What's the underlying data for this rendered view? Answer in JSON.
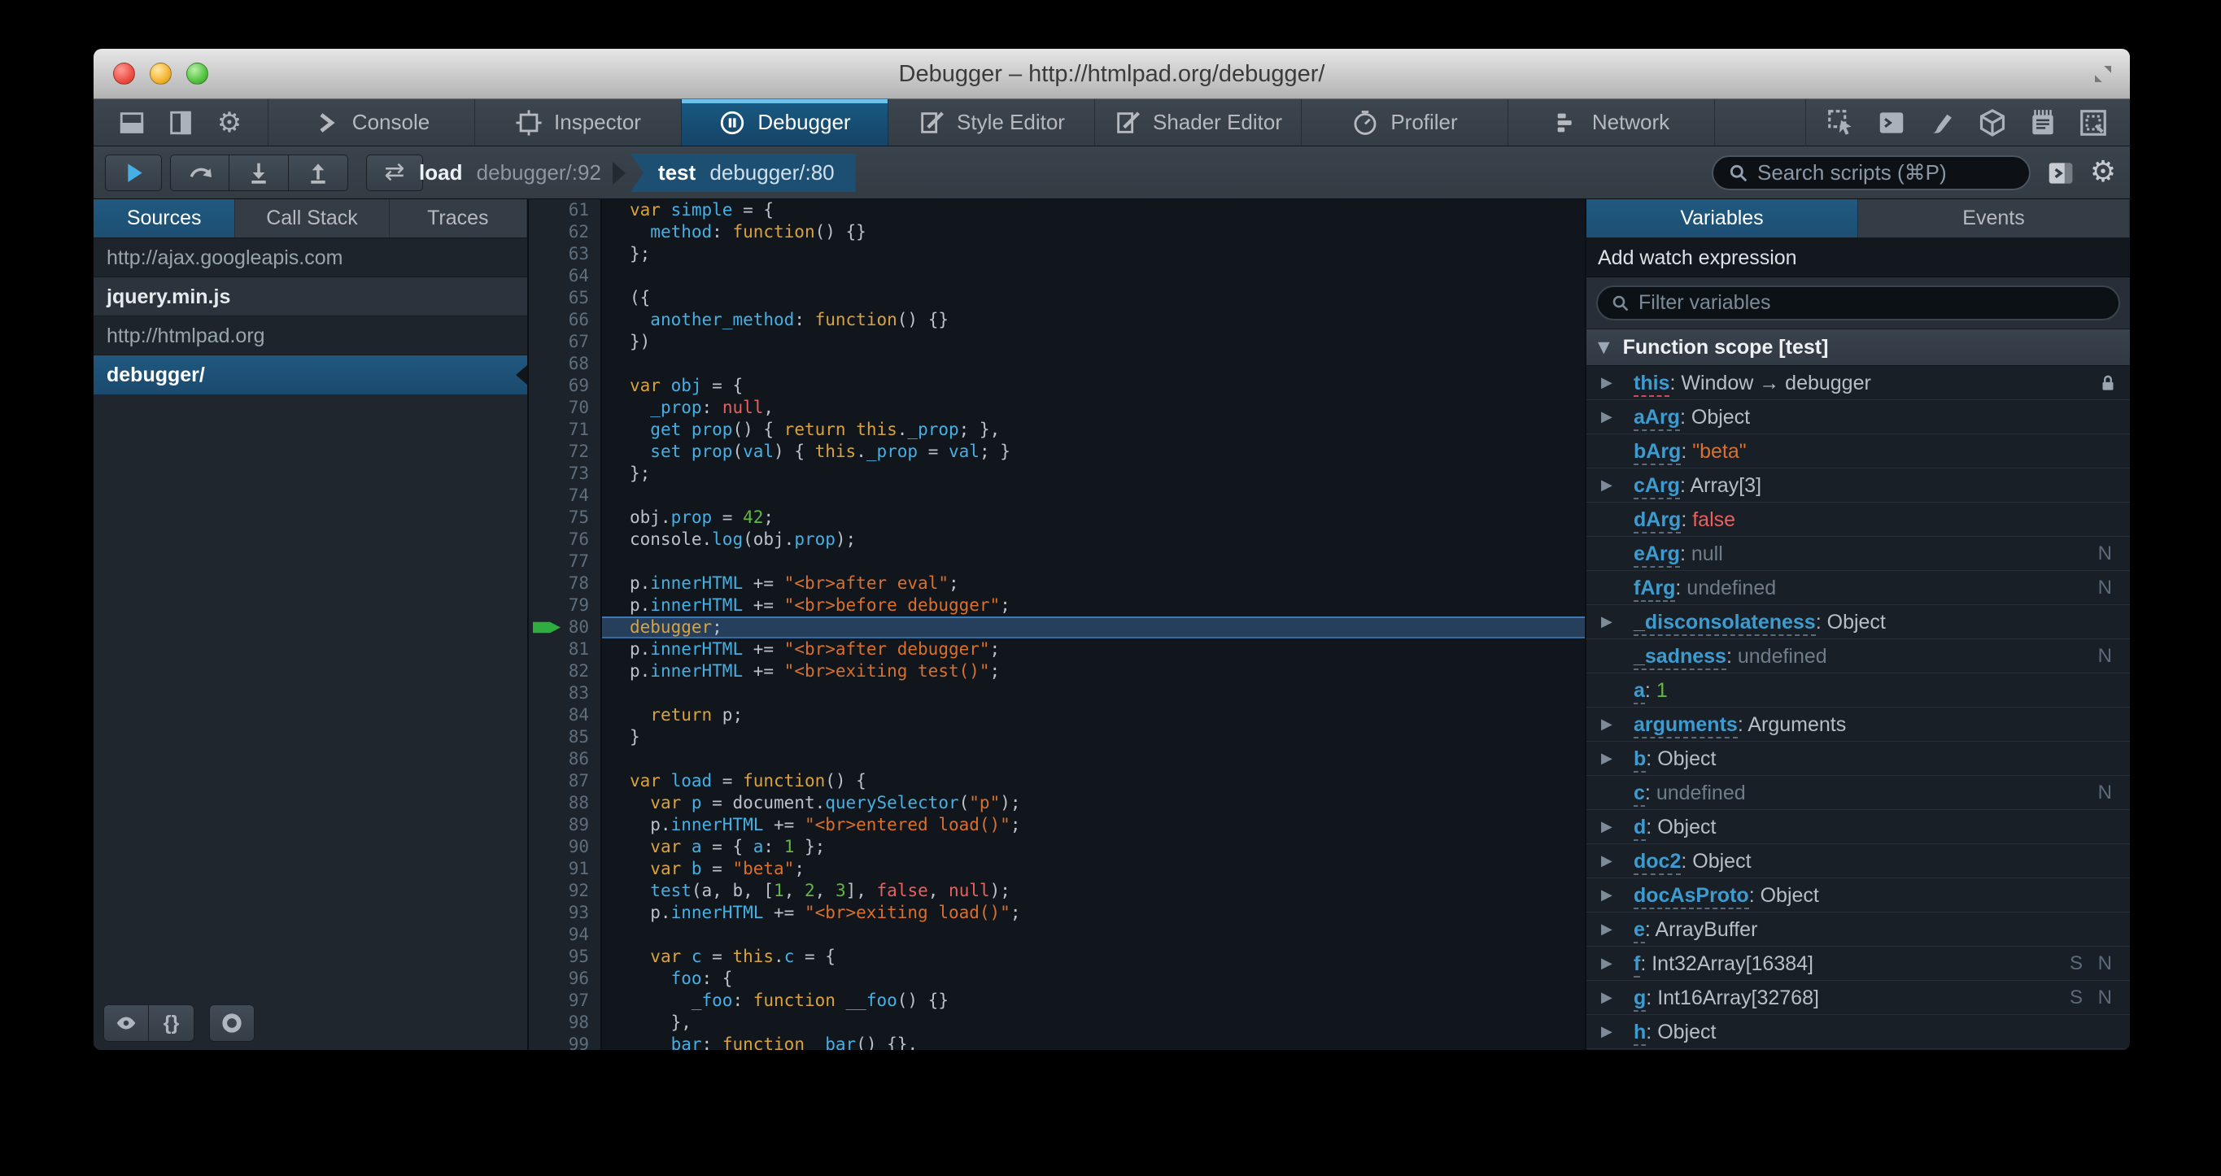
{
  "win": {
    "title": "Debugger – http://htmlpad.org/debugger/"
  },
  "colors": {
    "accent_blue": "#1d4f73",
    "tab_stripe": "#6cc1ea",
    "resume_blue": "#46afe3",
    "exec_arrow_green": "#2fae3f",
    "keyword": "#d9a23c",
    "identifier": "#46afe3",
    "string": "#d9702d",
    "number": "#64b648",
    "atom": "#e9605f"
  },
  "toolbar": {
    "dock_icons": [
      "dock-bottom",
      "dock-side",
      "toolbox-options"
    ],
    "tabs": [
      {
        "id": "console",
        "label": "Console"
      },
      {
        "id": "inspector",
        "label": "Inspector"
      },
      {
        "id": "debugger",
        "label": "Debugger",
        "active": true
      },
      {
        "id": "style-editor",
        "label": "Style Editor"
      },
      {
        "id": "shader-editor",
        "label": "Shader Editor"
      },
      {
        "id": "profiler",
        "label": "Profiler"
      },
      {
        "id": "network",
        "label": "Network"
      }
    ],
    "command_icons": [
      "pick-element",
      "split-console",
      "paintbrush",
      "tilt-3d",
      "scratchpad",
      "responsive-mode"
    ]
  },
  "debugbar": {
    "buttons": [
      "resume",
      "step-over",
      "step-in",
      "step-out",
      "blackbox"
    ],
    "crumbs": [
      {
        "fn": "load",
        "loc": "debugger/:92",
        "active": false
      },
      {
        "fn": "test",
        "loc": "debugger/:80",
        "active": true
      }
    ],
    "search_placeholder": "Search scripts (⌘P)"
  },
  "sources": {
    "tabs": [
      {
        "label": "Sources",
        "active": true
      },
      {
        "label": "Call Stack",
        "active": false
      },
      {
        "label": "Traces",
        "active": false
      }
    ],
    "items": [
      {
        "label": "http://ajax.googleapis.com",
        "kind": "header"
      },
      {
        "label": "jquery.min.js",
        "kind": "item"
      },
      {
        "label": "http://htmlpad.org",
        "kind": "header"
      },
      {
        "label": "debugger/",
        "kind": "selected"
      }
    ],
    "footer_buttons": [
      "blackbox-eye",
      "pretty-print",
      "toggle-breakpoints"
    ],
    "pretty_print_label": "{}"
  },
  "editor": {
    "first_line": 61,
    "exec_line": 80,
    "lines": [
      {
        "n": 61,
        "t": [
          [
            "k",
            "var "
          ],
          [
            "d",
            "simple"
          ],
          [
            "p",
            " = {"
          ]
        ]
      },
      {
        "n": 62,
        "t": [
          [
            "p",
            "  "
          ],
          [
            "d",
            "method"
          ],
          [
            "p",
            ": "
          ],
          [
            "k",
            "function"
          ],
          [
            "p",
            "() {}"
          ]
        ]
      },
      {
        "n": 63,
        "t": [
          [
            "p",
            "};"
          ]
        ]
      },
      {
        "n": 64,
        "t": []
      },
      {
        "n": 65,
        "t": [
          [
            "p",
            "({"
          ]
        ]
      },
      {
        "n": 66,
        "t": [
          [
            "p",
            "  "
          ],
          [
            "d",
            "another_method"
          ],
          [
            "p",
            ": "
          ],
          [
            "k",
            "function"
          ],
          [
            "p",
            "() {}"
          ]
        ]
      },
      {
        "n": 67,
        "t": [
          [
            "p",
            "})"
          ]
        ]
      },
      {
        "n": 68,
        "t": []
      },
      {
        "n": 69,
        "t": [
          [
            "k",
            "var "
          ],
          [
            "d",
            "obj"
          ],
          [
            "p",
            " = {"
          ]
        ]
      },
      {
        "n": 70,
        "t": [
          [
            "p",
            "  "
          ],
          [
            "d",
            "_prop"
          ],
          [
            "p",
            ": "
          ],
          [
            "a",
            "null"
          ],
          [
            "p",
            ","
          ]
        ]
      },
      {
        "n": 71,
        "t": [
          [
            "p",
            "  "
          ],
          [
            "d",
            "get prop"
          ],
          [
            "p",
            "() { "
          ],
          [
            "k",
            "return "
          ],
          [
            "k",
            "this"
          ],
          [
            "p",
            "."
          ],
          [
            "d",
            "_prop"
          ],
          [
            "p",
            "; },"
          ]
        ]
      },
      {
        "n": 72,
        "t": [
          [
            "p",
            "  "
          ],
          [
            "d",
            "set prop"
          ],
          [
            "p",
            "("
          ],
          [
            "d",
            "val"
          ],
          [
            "p",
            ") { "
          ],
          [
            "k",
            "this"
          ],
          [
            "p",
            "."
          ],
          [
            "d",
            "_prop"
          ],
          [
            "p",
            " = "
          ],
          [
            "d",
            "val"
          ],
          [
            "p",
            "; }"
          ]
        ]
      },
      {
        "n": 73,
        "t": [
          [
            "p",
            "};"
          ]
        ]
      },
      {
        "n": 74,
        "t": []
      },
      {
        "n": 75,
        "t": [
          [
            "p",
            "obj."
          ],
          [
            "d",
            "prop"
          ],
          [
            "p",
            " = "
          ],
          [
            "n",
            "42"
          ],
          [
            "p",
            ";"
          ]
        ]
      },
      {
        "n": 76,
        "t": [
          [
            "p",
            "console."
          ],
          [
            "d",
            "log"
          ],
          [
            "p",
            "(obj."
          ],
          [
            "d",
            "prop"
          ],
          [
            "p",
            ");"
          ]
        ]
      },
      {
        "n": 77,
        "t": []
      },
      {
        "n": 78,
        "t": [
          [
            "p",
            "p."
          ],
          [
            "d",
            "innerHTML"
          ],
          [
            "p",
            " += "
          ],
          [
            "s",
            "\"<br>after eval\""
          ],
          [
            "p",
            ";"
          ]
        ]
      },
      {
        "n": 79,
        "t": [
          [
            "p",
            "p."
          ],
          [
            "d",
            "innerHTML"
          ],
          [
            "p",
            " += "
          ],
          [
            "s",
            "\"<br>before debugger\""
          ],
          [
            "p",
            ";"
          ]
        ]
      },
      {
        "n": 80,
        "exec": true,
        "t": [
          [
            "k",
            "debugger"
          ],
          [
            "p",
            ";"
          ]
        ]
      },
      {
        "n": 81,
        "t": [
          [
            "p",
            "p."
          ],
          [
            "d",
            "innerHTML"
          ],
          [
            "p",
            " += "
          ],
          [
            "s",
            "\"<br>after debugger\""
          ],
          [
            "p",
            ";"
          ]
        ]
      },
      {
        "n": 82,
        "t": [
          [
            "p",
            "p."
          ],
          [
            "d",
            "innerHTML"
          ],
          [
            "p",
            " += "
          ],
          [
            "s",
            "\"<br>exiting test()\""
          ],
          [
            "p",
            ";"
          ]
        ]
      },
      {
        "n": 83,
        "t": []
      },
      {
        "n": 84,
        "t": [
          [
            "p",
            "  "
          ],
          [
            "k",
            "return"
          ],
          [
            "p",
            " p;"
          ]
        ]
      },
      {
        "n": 85,
        "t": [
          [
            "p",
            "}"
          ]
        ]
      },
      {
        "n": 86,
        "t": []
      },
      {
        "n": 87,
        "t": [
          [
            "k",
            "var "
          ],
          [
            "d",
            "load"
          ],
          [
            "p",
            " = "
          ],
          [
            "k",
            "function"
          ],
          [
            "p",
            "() {"
          ]
        ]
      },
      {
        "n": 88,
        "t": [
          [
            "p",
            "  "
          ],
          [
            "k",
            "var "
          ],
          [
            "d",
            "p"
          ],
          [
            "p",
            " = document."
          ],
          [
            "d",
            "querySelector"
          ],
          [
            "p",
            "("
          ],
          [
            "s",
            "\"p\""
          ],
          [
            "p",
            ");"
          ]
        ]
      },
      {
        "n": 89,
        "t": [
          [
            "p",
            "  p."
          ],
          [
            "d",
            "innerHTML"
          ],
          [
            "p",
            " += "
          ],
          [
            "s",
            "\"<br>entered load()\""
          ],
          [
            "p",
            ";"
          ]
        ]
      },
      {
        "n": 90,
        "t": [
          [
            "p",
            "  "
          ],
          [
            "k",
            "var "
          ],
          [
            "d",
            "a"
          ],
          [
            "p",
            " = { "
          ],
          [
            "d",
            "a"
          ],
          [
            "p",
            ": "
          ],
          [
            "n",
            "1"
          ],
          [
            "p",
            " };"
          ]
        ]
      },
      {
        "n": 91,
        "t": [
          [
            "p",
            "  "
          ],
          [
            "k",
            "var "
          ],
          [
            "d",
            "b"
          ],
          [
            "p",
            " = "
          ],
          [
            "s",
            "\"beta\""
          ],
          [
            "p",
            ";"
          ]
        ]
      },
      {
        "n": 92,
        "t": [
          [
            "p",
            "  "
          ],
          [
            "d",
            "test"
          ],
          [
            "p",
            "(a, b, ["
          ],
          [
            "n",
            "1"
          ],
          [
            "p",
            ", "
          ],
          [
            "n",
            "2"
          ],
          [
            "p",
            ", "
          ],
          [
            "n",
            "3"
          ],
          [
            "p",
            "], "
          ],
          [
            "a",
            "false"
          ],
          [
            "p",
            ", "
          ],
          [
            "a",
            "null"
          ],
          [
            "p",
            ");"
          ]
        ]
      },
      {
        "n": 93,
        "t": [
          [
            "p",
            "  p."
          ],
          [
            "d",
            "innerHTML"
          ],
          [
            "p",
            " += "
          ],
          [
            "s",
            "\"<br>exiting load()\""
          ],
          [
            "p",
            ";"
          ]
        ]
      },
      {
        "n": 94,
        "t": []
      },
      {
        "n": 95,
        "t": [
          [
            "p",
            "  "
          ],
          [
            "k",
            "var "
          ],
          [
            "d",
            "c"
          ],
          [
            "p",
            " = "
          ],
          [
            "k",
            "this"
          ],
          [
            "p",
            "."
          ],
          [
            "d",
            "c"
          ],
          [
            "p",
            " = {"
          ]
        ]
      },
      {
        "n": 96,
        "t": [
          [
            "p",
            "    "
          ],
          [
            "d",
            "foo"
          ],
          [
            "p",
            ": {"
          ]
        ]
      },
      {
        "n": 97,
        "t": [
          [
            "p",
            "      "
          ],
          [
            "d",
            "_foo"
          ],
          [
            "p",
            ": "
          ],
          [
            "k",
            "function "
          ],
          [
            "d",
            "__foo"
          ],
          [
            "p",
            "() {}"
          ]
        ]
      },
      {
        "n": 98,
        "t": [
          [
            "p",
            "    },"
          ]
        ]
      },
      {
        "n": 99,
        "t": [
          [
            "p",
            "    "
          ],
          [
            "d",
            "bar"
          ],
          [
            "p",
            ": "
          ],
          [
            "k",
            "function "
          ],
          [
            "d",
            "_bar"
          ],
          [
            "p",
            "() {},"
          ]
        ]
      }
    ]
  },
  "variables": {
    "tabs": [
      {
        "label": "Variables",
        "active": true
      },
      {
        "label": "Events",
        "active": false
      }
    ],
    "watch_label": "Add watch expression",
    "filter_placeholder": "Filter variables",
    "scope_label": "Function scope [test]",
    "rows": [
      {
        "name": "this",
        "value": "Window → debugger",
        "v": "obj",
        "arrow": true,
        "lock": true,
        "special": true
      },
      {
        "name": "aArg",
        "value": "Object",
        "v": "obj",
        "arrow": true
      },
      {
        "name": "bArg",
        "value": "\"beta\"",
        "v": "str"
      },
      {
        "name": "cArg",
        "value": "Array[3]",
        "v": "obj",
        "arrow": true
      },
      {
        "name": "dArg",
        "value": "false",
        "v": "bool"
      },
      {
        "name": "eArg",
        "value": "null",
        "v": "dim",
        "flags": "N"
      },
      {
        "name": "fArg",
        "value": "undefined",
        "v": "dim",
        "flags": "N"
      },
      {
        "name": "_disconsolateness",
        "value": "Object",
        "v": "obj",
        "arrow": true
      },
      {
        "name": "_sadness",
        "value": "undefined",
        "v": "dim",
        "flags": "N"
      },
      {
        "name": "a",
        "value": "1",
        "v": "num"
      },
      {
        "name": "arguments",
        "value": "Arguments",
        "v": "obj",
        "arrow": true
      },
      {
        "name": "b",
        "value": "Object",
        "v": "obj",
        "arrow": true
      },
      {
        "name": "c",
        "value": "undefined",
        "v": "dim",
        "flags": "N"
      },
      {
        "name": "d",
        "value": "Object",
        "v": "obj",
        "arrow": true
      },
      {
        "name": "doc2",
        "value": "Object",
        "v": "obj",
        "arrow": true
      },
      {
        "name": "docAsProto",
        "value": "Object",
        "v": "obj",
        "arrow": true
      },
      {
        "name": "e",
        "value": "ArrayBuffer",
        "v": "obj",
        "arrow": true
      },
      {
        "name": "f",
        "value": "Int32Array[16384]",
        "v": "obj",
        "arrow": true,
        "flags": "S N"
      },
      {
        "name": "g",
        "value": "Int16Array[32768]",
        "v": "obj",
        "arrow": true,
        "flags": "S N"
      },
      {
        "name": "h",
        "value": "Object",
        "v": "obj",
        "arrow": true
      }
    ]
  }
}
